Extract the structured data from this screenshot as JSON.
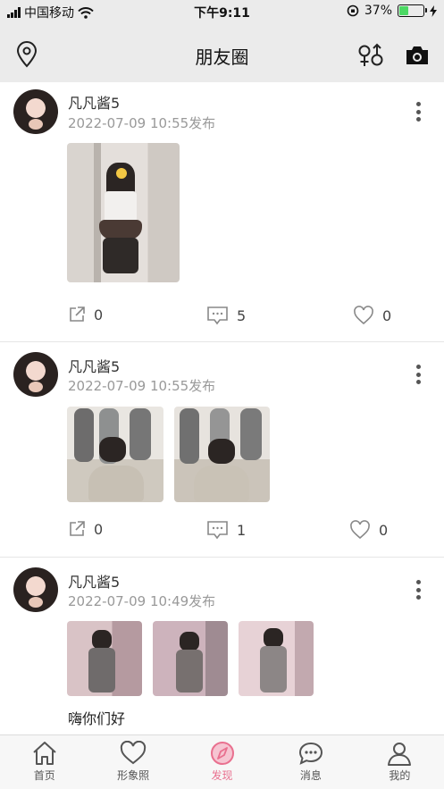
{
  "status_bar": {
    "carrier": "中国移动",
    "time": "下午9:11",
    "battery": "37%",
    "battery_level": 0.37
  },
  "header": {
    "title": "朋友圈",
    "left_icon": "location-pin-icon",
    "right_icons": [
      "gender-filter-icon",
      "camera-icon"
    ]
  },
  "posts": [
    {
      "username": "凡凡酱5",
      "time": "2022-07-09 10:55发布",
      "text": "",
      "photo_count": 1,
      "share_count": "0",
      "comment_count": "5",
      "like_count": "0"
    },
    {
      "username": "凡凡酱5",
      "time": "2022-07-09 10:55发布",
      "text": "",
      "photo_count": 2,
      "share_count": "0",
      "comment_count": "1",
      "like_count": "0"
    },
    {
      "username": "凡凡酱5",
      "time": "2022-07-09 10:49发布",
      "text": "嗨你们好",
      "photo_count": 3
    }
  ],
  "tabs": [
    {
      "label": "首页",
      "icon": "home-icon"
    },
    {
      "label": "形象照",
      "icon": "heart-icon"
    },
    {
      "label": "发现",
      "icon": "compass-icon",
      "active": true
    },
    {
      "label": "消息",
      "icon": "chat-bubble-icon"
    },
    {
      "label": "我的",
      "icon": "profile-icon"
    }
  ],
  "colors": {
    "accent": "#e9708f",
    "header_bg": "#ebebeb",
    "battery_green": "#4cd964"
  }
}
